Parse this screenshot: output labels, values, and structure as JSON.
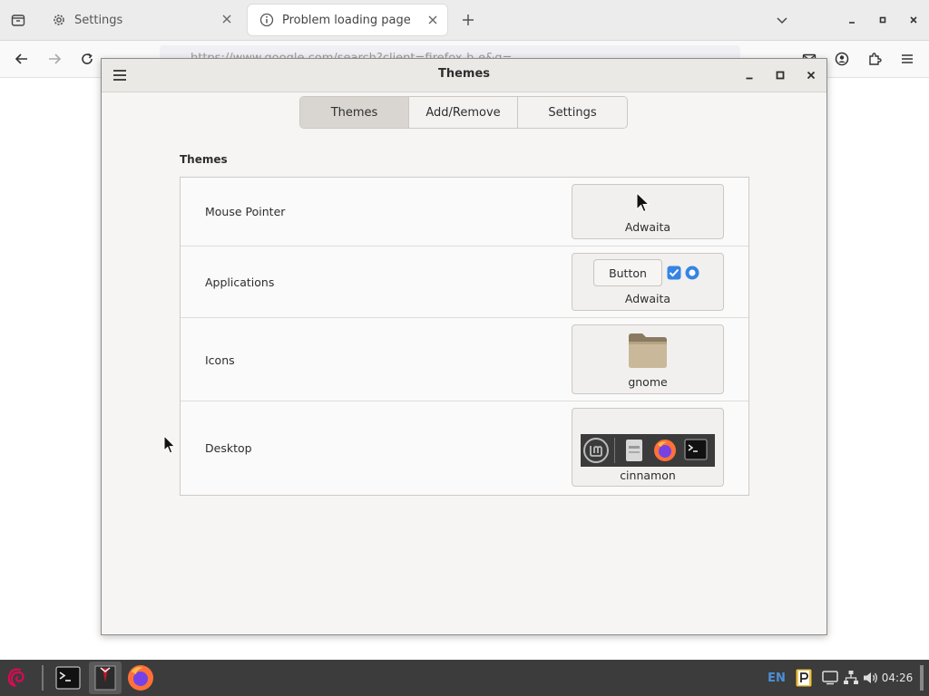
{
  "browser": {
    "tabs": [
      {
        "label": "Settings",
        "icon": "gear-icon",
        "active": false
      },
      {
        "label": "Problem loading page",
        "icon": "info-icon",
        "active": true
      }
    ],
    "url": "https://www.google.com/search?client=firefox-b-e&q=..."
  },
  "dialog": {
    "title": "Themes",
    "tabs": [
      {
        "label": "Themes",
        "active": true
      },
      {
        "label": "Add/Remove",
        "active": false
      },
      {
        "label": "Settings",
        "active": false
      }
    ],
    "section_title": "Themes",
    "rows": [
      {
        "label": "Mouse Pointer",
        "value": "Adwaita"
      },
      {
        "label": "Applications",
        "value": "Adwaita",
        "preview_button": "Button"
      },
      {
        "label": "Icons",
        "value": "gnome"
      },
      {
        "label": "Desktop",
        "value": "cinnamon"
      }
    ]
  },
  "taskbar": {
    "language": "EN",
    "clock": "04:26"
  },
  "colors": {
    "accent": "#3584e4",
    "taskbar": "#3c3c3c",
    "dialog_bg": "#f6f5f4"
  }
}
